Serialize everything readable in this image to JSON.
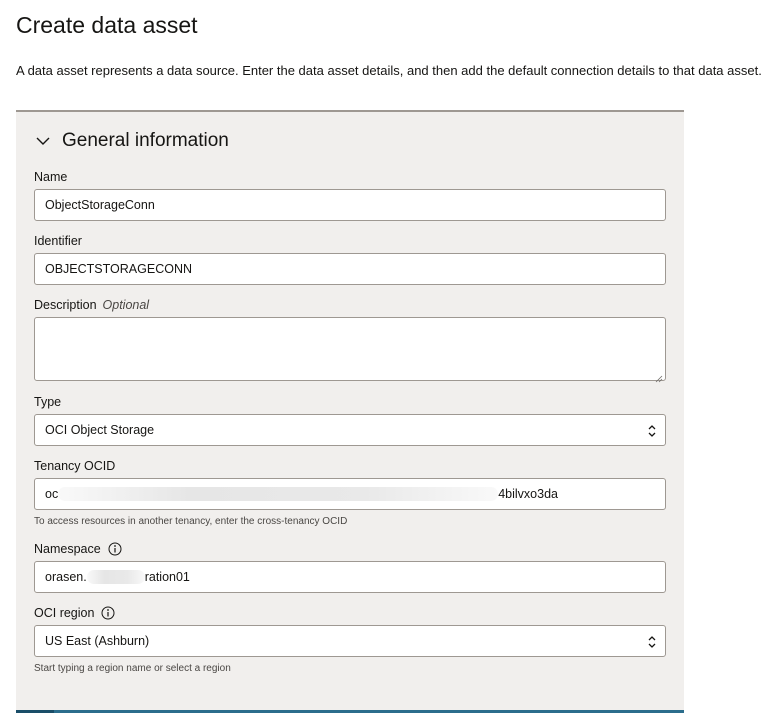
{
  "page": {
    "title": "Create data asset",
    "intro": "A data asset represents a data source. Enter the data asset details, and then add the default connection details to that data asset."
  },
  "general": {
    "section_title": "General information",
    "chevron_icon": "chevron-down-icon",
    "name": {
      "label": "Name",
      "value": "ObjectStorageConn"
    },
    "identifier": {
      "label": "Identifier",
      "value": "OBJECTSTORAGECONN"
    },
    "description": {
      "label": "Description",
      "optional": "Optional",
      "value": ""
    },
    "type": {
      "label": "Type",
      "value": "OCI Object Storage"
    },
    "tenancy": {
      "label": "Tenancy OCID",
      "value_start": "oc",
      "value_end": "4bilvxo3da",
      "help": "To access resources in another tenancy, enter the cross-tenancy OCID"
    },
    "namespace": {
      "label": "Namespace",
      "value_start": "orasen.",
      "value_end": "ration01",
      "info_icon": "info-icon"
    },
    "region": {
      "label": "OCI region",
      "value": "US East (Ashburn)",
      "help": "Start typing a region name or select a region",
      "info_icon": "info-icon"
    }
  },
  "colors": {
    "panel_bg": "#f1efed",
    "border": "#9e9892",
    "accent": "#2b6d8c"
  }
}
